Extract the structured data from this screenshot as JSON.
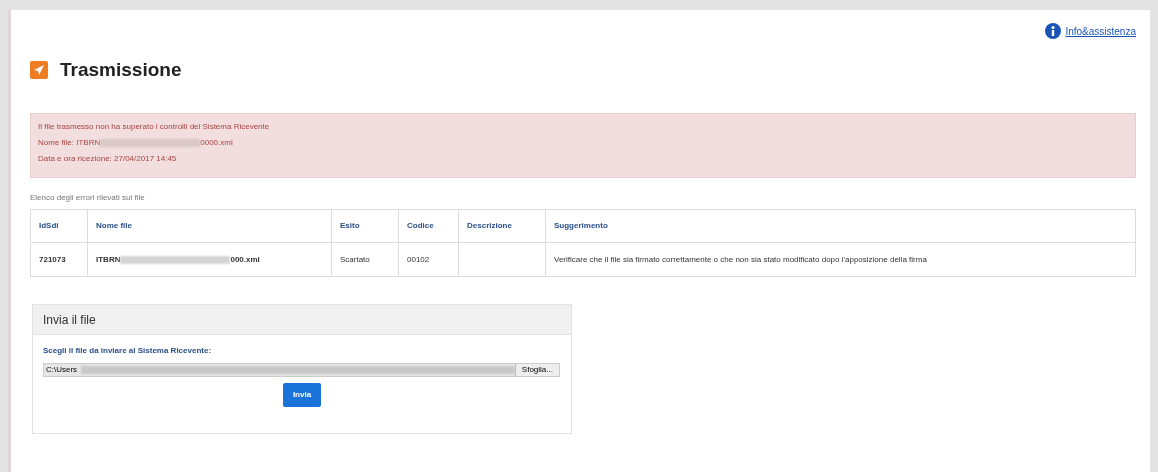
{
  "page": {
    "title": "Trasmissione",
    "help_link": "Info&assistenza"
  },
  "alert": {
    "message": "Il file trasmesso non ha superato i controlli del Sistema Ricevente",
    "file_label": "Nome file: ITBRN",
    "file_suffix": "0000.xml",
    "date_line": "Data e ora ricezione: 27/04/2017 14:45"
  },
  "errors_caption": "Elenco degli errori rilevati sul file",
  "table": {
    "columns": [
      "IdSdi",
      "Nome file",
      "Esito",
      "Codice",
      "Descrizione",
      "Suggerimento"
    ],
    "rows": [
      {
        "id": "721073",
        "name_prefix": "ITBRN",
        "name_suffix": "000.xml",
        "outcome": "Scartato",
        "code": "00102",
        "suggestion": "Verificare che il file sia firmato correttamente o che non sia stato modificato dopo l'apposizione della firma"
      }
    ]
  },
  "upload": {
    "title": "Invia il file",
    "label": "Scegli il file da inviare al Sistema Ricevente:",
    "path": "C:\\Users",
    "browse": "Sfoglia...",
    "submit": "Invia"
  }
}
